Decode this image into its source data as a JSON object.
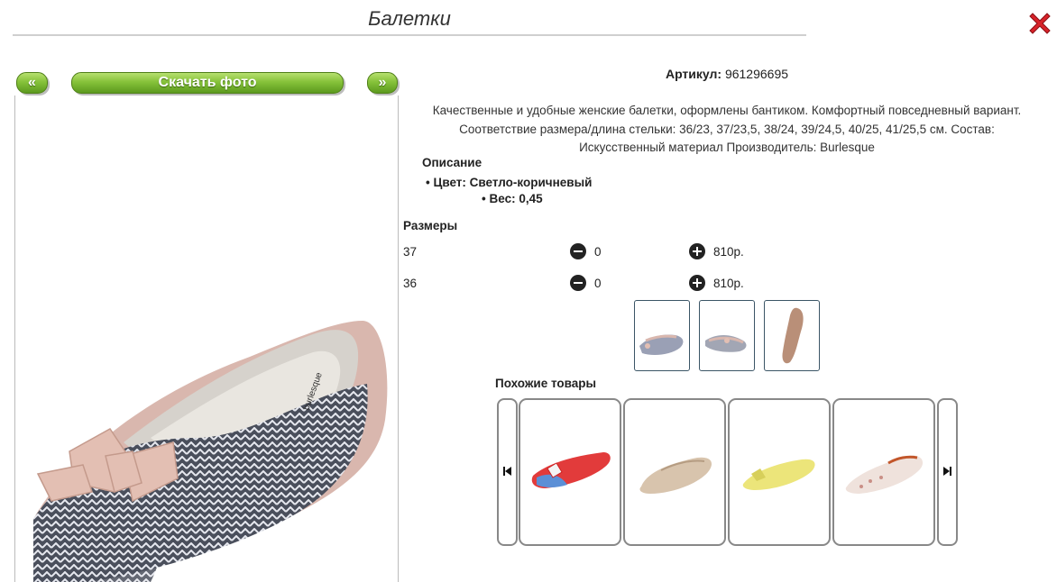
{
  "header": {
    "title": "Балетки"
  },
  "toolbar": {
    "prev_label": "«",
    "download_label": "Скачать фото",
    "next_label": "»"
  },
  "product": {
    "article_label": "Артикул:",
    "article_value": "961296695",
    "description_lines": [
      "Качественные и удобные женские балетки, оформлены бантиком. Комфортный повседневный вариант.",
      "Соответствие размера/длина стельки: 36/23, 37/23,5, 38/24, 39/24,5, 40/25, 41/25,5 см. Состав:",
      "Искусственный материал Производитель: Burlesque"
    ],
    "description_title": "Описание",
    "color_text": "Цвет: Светло-коричневый",
    "weight_text": "Вес: 0,45"
  },
  "sizes": {
    "title": "Размеры",
    "rows": [
      {
        "size": "37",
        "qty": "0",
        "price": "810р."
      },
      {
        "size": "36",
        "qty": "0",
        "price": "810р."
      }
    ]
  },
  "similar": {
    "title": "Похожие товары"
  },
  "colors": {
    "accent_green": "#86c23a",
    "close_red": "#d8232a"
  }
}
